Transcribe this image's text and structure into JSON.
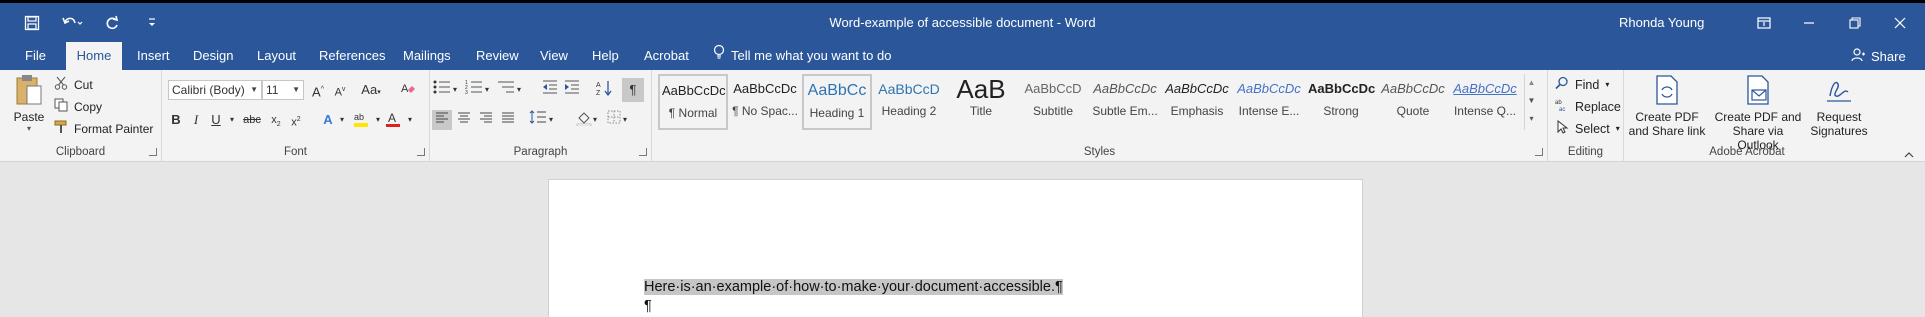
{
  "window": {
    "title": "Word-example of accessible document  -  Word",
    "user": "Rhonda Young"
  },
  "tabs": [
    {
      "label": "File"
    },
    {
      "label": "Home"
    },
    {
      "label": "Insert"
    },
    {
      "label": "Design"
    },
    {
      "label": "Layout"
    },
    {
      "label": "References"
    },
    {
      "label": "Mailings"
    },
    {
      "label": "Review"
    },
    {
      "label": "View"
    },
    {
      "label": "Help"
    },
    {
      "label": "Acrobat"
    }
  ],
  "tell_me": "Tell me what you want to do",
  "share_label": "Share",
  "clipboard": {
    "paste": "Paste",
    "cut": "Cut",
    "copy": "Copy",
    "format_painter": "Format Painter",
    "group_label": "Clipboard"
  },
  "font": {
    "name": "Calibri (Body)",
    "size": "11",
    "group_label": "Font"
  },
  "paragraph": {
    "group_label": "Paragraph"
  },
  "styles": {
    "group_label": "Styles",
    "items": [
      {
        "sample": "AaBbCcDc",
        "name": "¶ Normal"
      },
      {
        "sample": "AaBbCcDc",
        "name": "¶ No Spac..."
      },
      {
        "sample": "AaBbCc",
        "name": "Heading 1"
      },
      {
        "sample": "AaBbCcD",
        "name": "Heading 2"
      },
      {
        "sample": "AaB",
        "name": "Title"
      },
      {
        "sample": "AaBbCcD",
        "name": "Subtitle"
      },
      {
        "sample": "AaBbCcDc",
        "name": "Subtle Em..."
      },
      {
        "sample": "AaBbCcDc",
        "name": "Emphasis"
      },
      {
        "sample": "AaBbCcDc",
        "name": "Intense E..."
      },
      {
        "sample": "AaBbCcDc",
        "name": "Strong"
      },
      {
        "sample": "AaBbCcDc",
        "name": "Quote"
      },
      {
        "sample": "AaBbCcDc",
        "name": "Intense Q..."
      }
    ]
  },
  "editing": {
    "find": "Find",
    "replace": "Replace",
    "select": "Select",
    "group_label": "Editing"
  },
  "acrobat": {
    "create_pdf_1": "Create PDF",
    "create_pdf_2": "and Share link",
    "outlook_1": "Create PDF and",
    "outlook_2": "Share via Outlook",
    "request_1": "Request",
    "request_2": "Signatures",
    "group_label": "Adobe Acrobat"
  },
  "document": {
    "line1": "Here·is·an·example·of·how·to·make·your·document·accessible.¶",
    "line2": "¶"
  },
  "colors": {
    "brand": "#2b579a",
    "ribbon": "#f3f3f3",
    "canvas": "#e6e6e6"
  }
}
